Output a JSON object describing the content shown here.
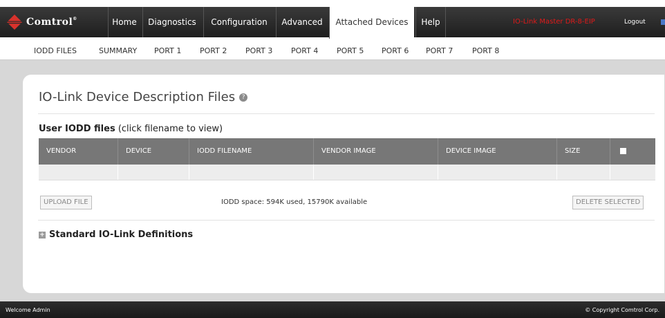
{
  "brand": {
    "name": "Comtrol",
    "trademark": "®"
  },
  "nav": {
    "tabs": [
      "Home",
      "Diagnostics",
      "Configuration",
      "Advanced",
      "Attached Devices",
      "Help"
    ],
    "active": "Attached Devices",
    "device_name": "IO-Link Master DR-8-EIP",
    "logout": "Logout"
  },
  "subnav": [
    "IODD FILES",
    "SUMMARY",
    "PORT 1",
    "PORT 2",
    "PORT 3",
    "PORT 4",
    "PORT 5",
    "PORT 6",
    "PORT 7",
    "PORT 8"
  ],
  "page": {
    "title": "IO-Link Device Description Files",
    "help_glyph": "?",
    "section_bold": "User IODD files",
    "section_note": " (click filename to view)"
  },
  "table": {
    "headers": [
      "VENDOR",
      "DEVICE",
      "IODD FILENAME",
      "VENDOR IMAGE",
      "DEVICE IMAGE",
      "SIZE"
    ],
    "rows": [
      [
        "",
        "",
        "",
        "",
        "",
        "",
        ""
      ]
    ]
  },
  "actions": {
    "upload": "UPLOAD FILE",
    "space": "IODD space: 594K used, 15790K available",
    "delete": "DELETE SELECTED"
  },
  "standard": {
    "label": "Standard IO-Link Definitions",
    "expand_glyph": "+"
  },
  "footer": {
    "welcome": "Welcome Admin",
    "copyright": "© Copyright Comtrol Corp."
  },
  "colors": {
    "nav_bg": "#2a2a2a",
    "header_gray": "#777777",
    "device_red": "#e01919",
    "logo_red": "#d8322c"
  },
  "icons": [
    "comtrol-logo-icon",
    "help-icon",
    "checkbox-icon",
    "plus-icon",
    "language-flag-icon"
  ]
}
